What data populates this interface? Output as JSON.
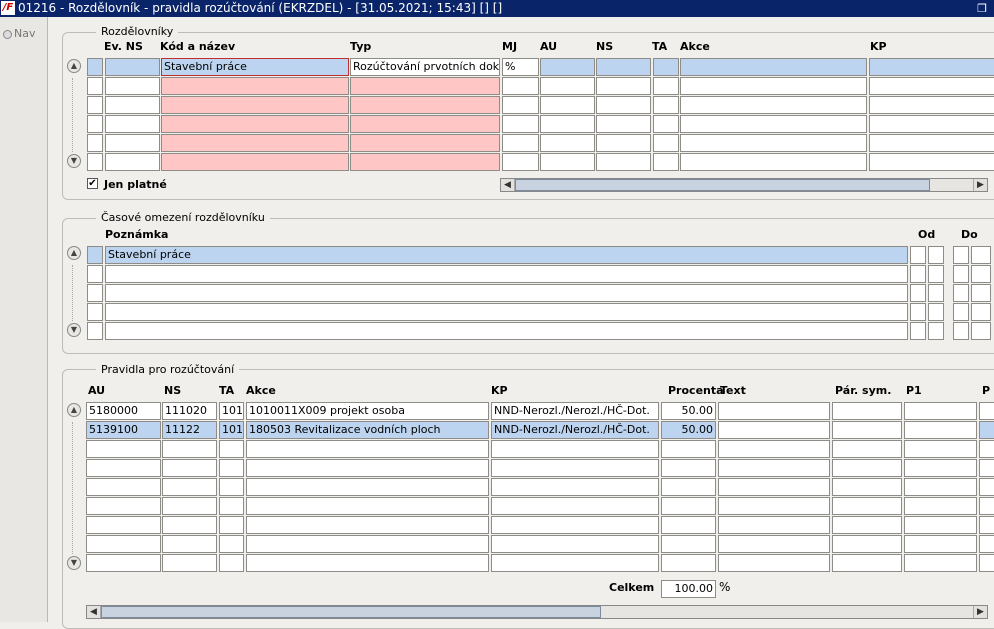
{
  "window": {
    "title": "01216 - Rozdělovník - pravidla rozúčtování (EKRZDEL) - [31.05.2021; 15:43]  [] []"
  },
  "nav": {
    "label": "Nav"
  },
  "rozdelovniky": {
    "legend": "Rozdělovníky",
    "columns": {
      "ev_ns": "Ev. NS",
      "kod_nazev": "Kód a název",
      "typ": "Typ",
      "mj": "MJ",
      "au": "AU",
      "ns": "NS",
      "ta": "TA",
      "akce": "Akce",
      "kp": "KP"
    },
    "rows": [
      {
        "ev_ns": "",
        "kod_nazev": "Stavební práce",
        "typ": "Rozúčtování prvotních dokladů",
        "mj": "%",
        "au": "",
        "ns": "",
        "ta": "",
        "akce": "",
        "kp": ""
      },
      {
        "ev_ns": "",
        "kod_nazev": "",
        "typ": "",
        "mj": "",
        "au": "",
        "ns": "",
        "ta": "",
        "akce": "",
        "kp": ""
      },
      {
        "ev_ns": "",
        "kod_nazev": "",
        "typ": "",
        "mj": "",
        "au": "",
        "ns": "",
        "ta": "",
        "akce": "",
        "kp": ""
      },
      {
        "ev_ns": "",
        "kod_nazev": "",
        "typ": "",
        "mj": "",
        "au": "",
        "ns": "",
        "ta": "",
        "akce": "",
        "kp": ""
      },
      {
        "ev_ns": "",
        "kod_nazev": "",
        "typ": "",
        "mj": "",
        "au": "",
        "ns": "",
        "ta": "",
        "akce": "",
        "kp": ""
      },
      {
        "ev_ns": "",
        "kod_nazev": "",
        "typ": "",
        "mj": "",
        "au": "",
        "ns": "",
        "ta": "",
        "akce": "",
        "kp": ""
      }
    ],
    "jen_platne": {
      "label": "Jen platné",
      "checked": true
    }
  },
  "casove": {
    "legend": "Časové omezení rozdělovníku",
    "columns": {
      "poznamka": "Poznámka",
      "od": "Od",
      "do": "Do"
    },
    "rows": [
      {
        "poznamka": "Stavební práce"
      },
      {
        "poznamka": ""
      },
      {
        "poznamka": ""
      },
      {
        "poznamka": ""
      },
      {
        "poznamka": ""
      }
    ]
  },
  "pravidla": {
    "legend": "Pravidla pro rozúčtování",
    "columns": {
      "au": "AU",
      "ns": "NS",
      "ta": "TA",
      "akce": "Akce",
      "kp": "KP",
      "procenta": "Procenta",
      "text": "Text",
      "par_sym": "Pár. sym.",
      "p1": "P1",
      "p2": "P"
    },
    "rows": [
      {
        "au": "5180000",
        "ns": "111020",
        "ta": "101",
        "akce": "1010011X009 projekt osoba",
        "kp": "NND-Nerozl./Nerozl./HČ-Dot.",
        "procenta": "50.00",
        "text": "",
        "par_sym": "",
        "p1": "",
        "p2": ""
      },
      {
        "au": "5139100",
        "ns": "11122",
        "ta": "101",
        "akce": "180503 Revitalizace vodních ploch",
        "kp": "NND-Nerozl./Nerozl./HČ-Dot.",
        "procenta": "50.00",
        "text": "",
        "par_sym": "",
        "p1": "",
        "p2": ""
      },
      {
        "au": "",
        "ns": "",
        "ta": "",
        "akce": "",
        "kp": "",
        "procenta": "",
        "text": "",
        "par_sym": "",
        "p1": "",
        "p2": ""
      },
      {
        "au": "",
        "ns": "",
        "ta": "",
        "akce": "",
        "kp": "",
        "procenta": "",
        "text": "",
        "par_sym": "",
        "p1": "",
        "p2": ""
      },
      {
        "au": "",
        "ns": "",
        "ta": "",
        "akce": "",
        "kp": "",
        "procenta": "",
        "text": "",
        "par_sym": "",
        "p1": "",
        "p2": ""
      },
      {
        "au": "",
        "ns": "",
        "ta": "",
        "akce": "",
        "kp": "",
        "procenta": "",
        "text": "",
        "par_sym": "",
        "p1": "",
        "p2": ""
      },
      {
        "au": "",
        "ns": "",
        "ta": "",
        "akce": "",
        "kp": "",
        "procenta": "",
        "text": "",
        "par_sym": "",
        "p1": "",
        "p2": ""
      },
      {
        "au": "",
        "ns": "",
        "ta": "",
        "akce": "",
        "kp": "",
        "procenta": "",
        "text": "",
        "par_sym": "",
        "p1": "",
        "p2": ""
      },
      {
        "au": "",
        "ns": "",
        "ta": "",
        "akce": "",
        "kp": "",
        "procenta": "",
        "text": "",
        "par_sym": "",
        "p1": "",
        "p2": ""
      }
    ],
    "celkem": {
      "label": "Celkem",
      "value": "100.00",
      "unit": "%"
    }
  },
  "icons": {
    "logo": "app-logo-icon",
    "restore": "restore-window-icon",
    "up": "scroll-up-icon",
    "down": "scroll-down-icon",
    "left": "scroll-left-icon",
    "right": "scroll-right-icon",
    "check": "checkmark-icon"
  },
  "colors": {
    "titlebar": "#0a246a",
    "selected_row": "#bcd4ef",
    "required_field": "#ffc6c6",
    "active_field_border": "#c03030"
  }
}
